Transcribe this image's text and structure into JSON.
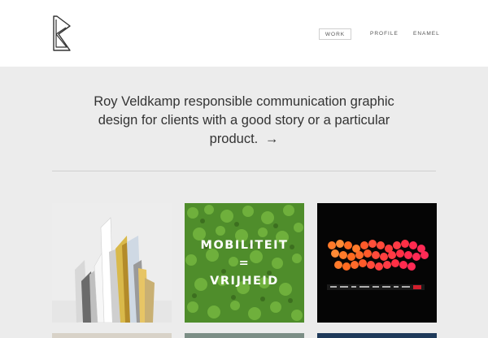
{
  "header": {
    "logo_name": "rv-monogram-logo",
    "nav": [
      {
        "label": "WORK",
        "active": true
      },
      {
        "label": "PROFILE",
        "active": false
      },
      {
        "label": "ENAMEL",
        "active": false
      }
    ]
  },
  "intro": {
    "text": "Roy Veldkamp responsible communication graphic design for clients with a good story or a particular product.",
    "arrow": "→"
  },
  "portfolio": {
    "tiles": [
      {
        "name": "books",
        "text_lines": []
      },
      {
        "name": "grass-poster",
        "text_lines": [
          "MOBILITEIT",
          "=",
          "VRIJHEID"
        ]
      },
      {
        "name": "candles",
        "text_lines": []
      }
    ]
  },
  "colors": {
    "background": "#ececec",
    "header_bg": "#ffffff",
    "text": "#333333",
    "grass": "#4e8f2a"
  }
}
